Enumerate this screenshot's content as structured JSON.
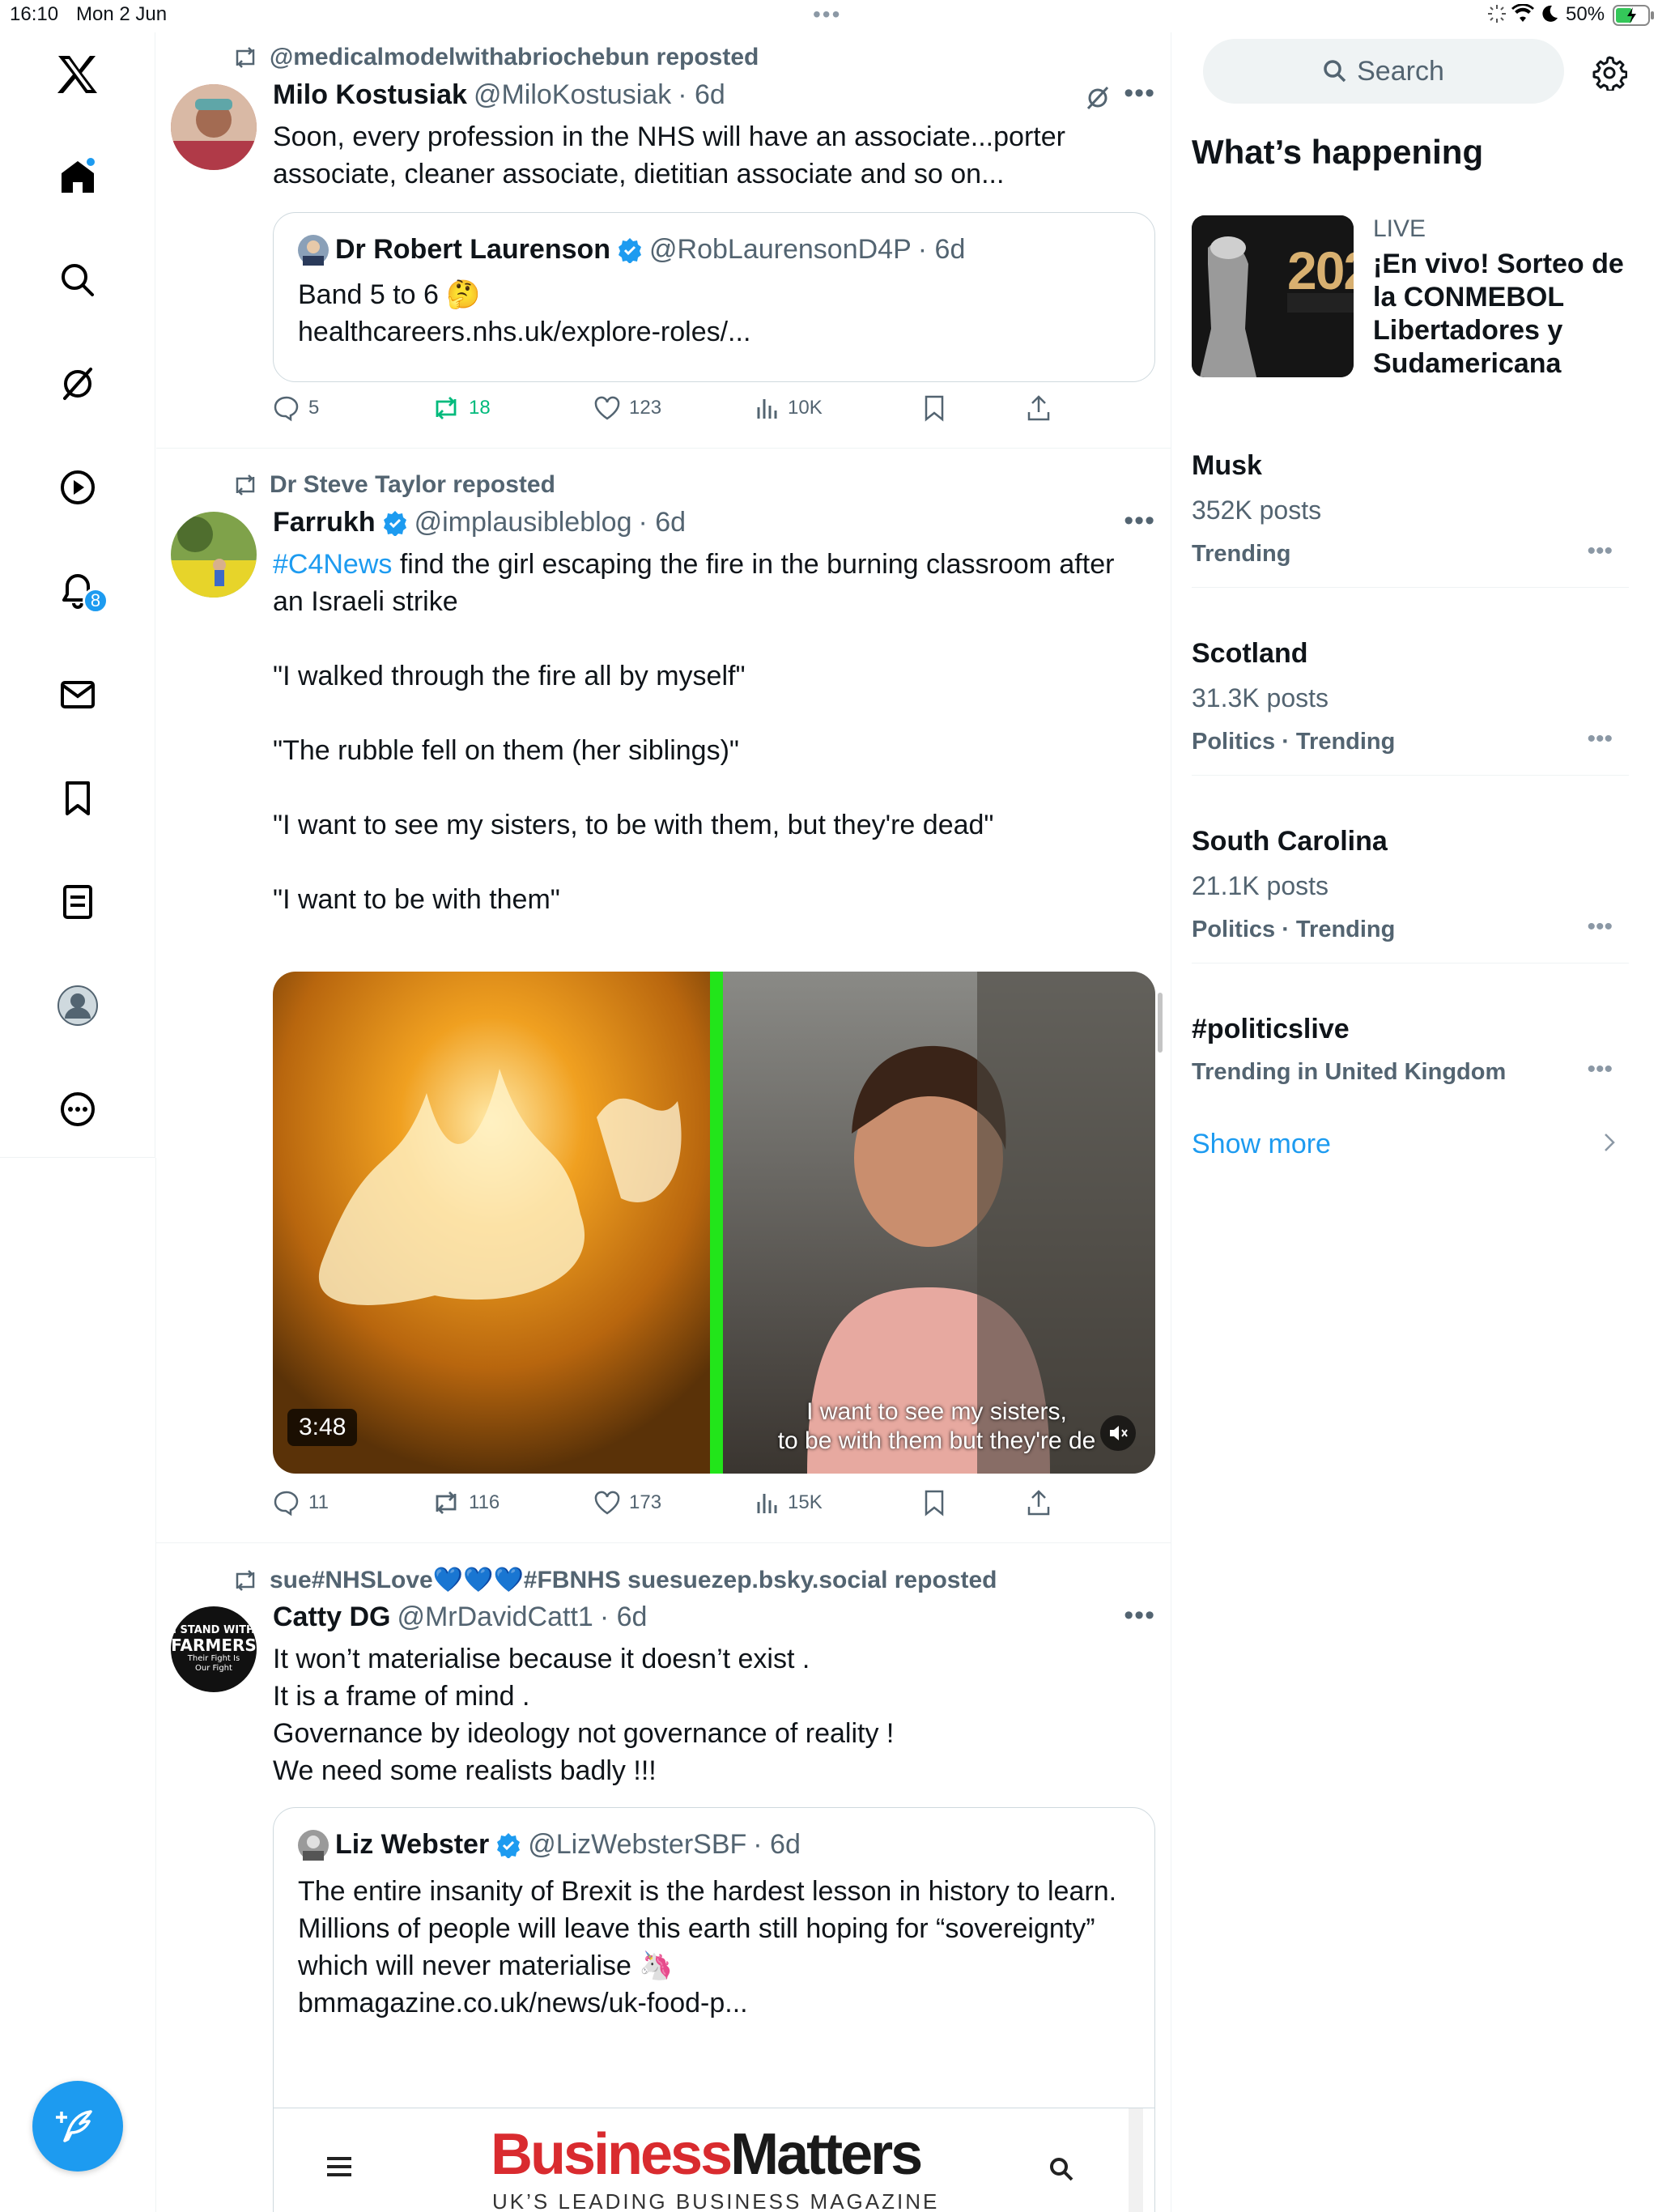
{
  "status": {
    "time": "16:10",
    "date": "Mon 2 Jun",
    "battery": "50%"
  },
  "sidebar": {
    "items": [
      {
        "name": "x-logo-icon"
      },
      {
        "name": "home-icon"
      },
      {
        "name": "search-icon"
      },
      {
        "name": "grok-icon"
      },
      {
        "name": "play-icon"
      },
      {
        "name": "bell-icon",
        "badge": "8"
      },
      {
        "name": "mail-icon"
      },
      {
        "name": "bookmark-icon"
      },
      {
        "name": "list-icon"
      },
      {
        "name": "profile-icon"
      },
      {
        "name": "more-icon"
      }
    ],
    "compose_icon": "feather-plus-icon"
  },
  "posts": [
    {
      "repost": "@medicalmodelwithabriochebun reposted",
      "name": "Milo Kostusiak",
      "handle": "@MiloKostusiak",
      "time": "· 6d",
      "lines": [
        "Soon, every profession in the NHS will have an associate...porter",
        "associate, cleaner associate, dietitian associate and so on..."
      ],
      "quote": {
        "name": "Dr Robert Laurenson",
        "handle": "@RobLaurensonD4P",
        "time": "· 6d",
        "lines": [
          "Band 5 to 6 🤔",
          "healthcareers.nhs.uk/explore-roles/..."
        ]
      },
      "stats": {
        "replies": "5",
        "reposts": "18",
        "likes": "123",
        "views": "10K"
      }
    },
    {
      "repost": "Dr Steve Taylor reposted",
      "name": "Farrukh",
      "handle": "@implausibleblog",
      "time": "· 6d",
      "hashtag": "#C4News",
      "line1_rest": " find the girl escaping the fire in the burning classroom after",
      "lines": [
        "an Israeli strike",
        "",
        "\"I walked through the fire all by myself\"",
        "",
        "\"The rubble fell on them (her siblings)\"",
        "",
        "\"I want to see my sisters, to be with them, but they're dead\"",
        "",
        "\"I want to be with them\""
      ],
      "video": {
        "duration": "3:48",
        "caption1": "I want to see my sisters,",
        "caption2": "to be with them but they're de"
      },
      "stats": {
        "replies": "11",
        "reposts": "116",
        "likes": "173",
        "views": "15K"
      }
    },
    {
      "repost": "sue#NHSLove💙💙💙#FBNHS suesuezep.bsky.social reposted",
      "name": "Catty DG",
      "handle": "@MrDavidCatt1",
      "time": "· 6d",
      "avatar_text": [
        "I STAND WITH",
        "FARMERS",
        "Their Fight Is",
        "Our Fight"
      ],
      "lines": [
        "It won’t materialise because it doesn’t exist .",
        "It is a frame of mind .",
        "Governance by ideology not governance of reality !",
        "We need some realists badly !!!"
      ],
      "quote": {
        "name": "Liz Webster",
        "handle": "@LizWebsterSBF",
        "time": "· 6d",
        "lines": [
          "The entire insanity of Brexit is the hardest lesson in history to learn.",
          "",
          "Millions of people will leave this earth still hoping for “sovereignty”",
          "which will never materialise 🦄",
          "",
          "bmmagazine.co.uk/news/uk-food-p..."
        ],
        "card": {
          "brand1": "Business",
          "brand2": "Matters",
          "tagline": "UK’S LEADING BUSINESS MAGAZINE"
        }
      }
    }
  ],
  "right": {
    "search_placeholder": "Search",
    "heading": "What’s happening",
    "live": {
      "label": "LIVE",
      "title_lines": [
        "¡En vivo! Sorteo de",
        "la CONMEBOL",
        "Libertadores y",
        "Sudamericana"
      ],
      "thumb_text": "202"
    },
    "trends": [
      {
        "title": "Musk",
        "posts": "352K posts",
        "meta": "Trending"
      },
      {
        "title": "Scotland",
        "posts": "31.3K posts",
        "meta": "Politics · Trending"
      },
      {
        "title": "South Carolina",
        "posts": "21.1K posts",
        "meta": "Politics · Trending"
      },
      {
        "title": "#politicslive",
        "posts": "",
        "meta": "Trending in United Kingdom"
      }
    ],
    "show_more": "Show more"
  },
  "colors": {
    "accent": "#1d9bf0",
    "repost_green": "#00ba7c",
    "text": "#0f1419",
    "muted": "#536471"
  }
}
